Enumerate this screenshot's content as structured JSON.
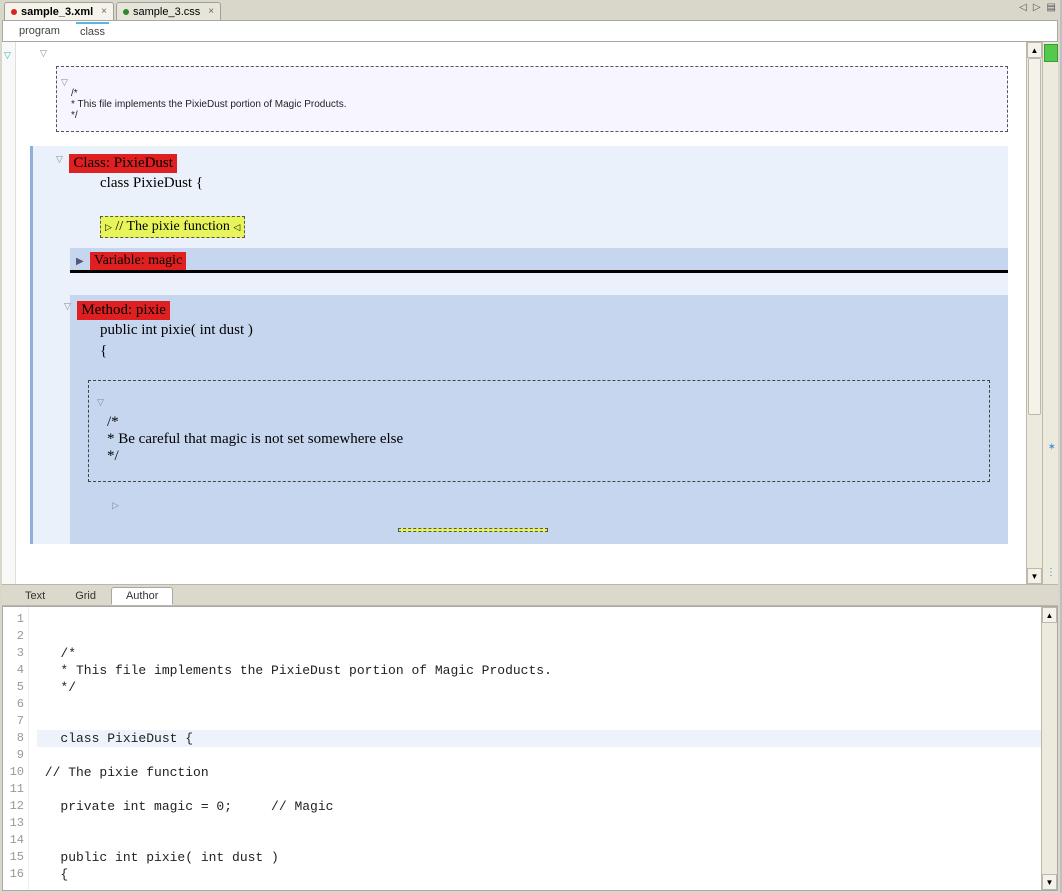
{
  "tabs": [
    {
      "label": "sample_3.xml",
      "dirty": true,
      "active": true
    },
    {
      "label": "sample_3.css",
      "dirty": false,
      "active": false
    }
  ],
  "nav_icons": {
    "left": "◁",
    "right": "▷",
    "menu": "▤"
  },
  "breadcrumb": [
    "program",
    "class"
  ],
  "author": {
    "top_comment": [
      "/*",
      "* This file implements the PixieDust portion of Magic Products.",
      "*/"
    ],
    "class_header": "Class: PixieDust",
    "class_decl": "class PixieDust {",
    "inline_note": "// The pixie function",
    "variable_header": "Variable: magic",
    "method_header": "Method: pixie",
    "method_sig": "public int pixie( int dust )",
    "method_open": "{",
    "method_comment": [
      "/*",
      "* Be careful that magic is not set somewhere else",
      "*/"
    ]
  },
  "mode_tabs": [
    "Text",
    "Grid",
    "Author"
  ],
  "mode_active": "Author",
  "source": {
    "start": 1,
    "highlight_line": 8,
    "lines": [
      "",
      "",
      "   /*",
      "   * This file implements the PixieDust portion of Magic Products.",
      "   */",
      "",
      "",
      "   class PixieDust {",
      "",
      " // The pixie function",
      "",
      "   private int magic = 0;     // Magic",
      "",
      "",
      "   public int pixie( int dust )",
      "   {"
    ]
  }
}
